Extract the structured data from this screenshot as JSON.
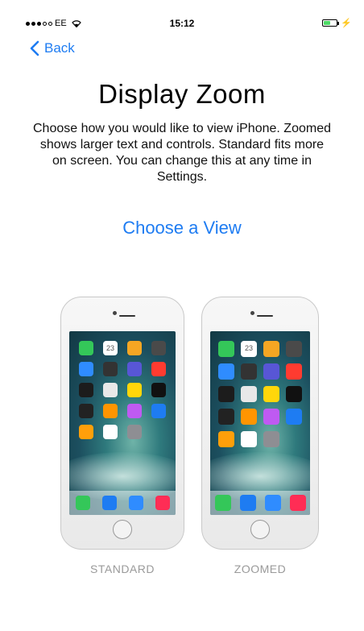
{
  "status": {
    "carrier": "EE",
    "time": "15:12",
    "signal_bars_filled": 3,
    "signal_bars_total": 5,
    "battery_level": 0.5,
    "charging": true
  },
  "nav": {
    "back_label": "Back"
  },
  "title": "Display Zoom",
  "description": "Choose how you would like to view iPhone. Zoomed shows larger text and controls. Standard fits more on screen. You can change this at any time in Settings.",
  "choose_label": "Choose a View",
  "options": [
    {
      "label": "STANDARD"
    },
    {
      "label": "ZOOMED"
    }
  ],
  "calendar_day": "23",
  "colors": {
    "accent": "#1e7cf2",
    "muted": "#9a9a9a",
    "battery": "#4cd964"
  },
  "app_colors": [
    "#34c759",
    "#ffffff",
    "#f5a623",
    "#4a4a4a",
    "#2f8cff",
    "#333333",
    "#5856d6",
    "#ff3b30",
    "#1c1c1c",
    "#e8e8e8",
    "#ffd60a",
    "#111111",
    "#222222",
    "#ff9500",
    "#bf5af2",
    "#1e7cf2",
    "#ff9f0a",
    "#ffffff",
    "#8e8e93"
  ],
  "dock_colors": [
    "#34c759",
    "#1e7cf2",
    "#2f8cff",
    "#ff2d55"
  ]
}
